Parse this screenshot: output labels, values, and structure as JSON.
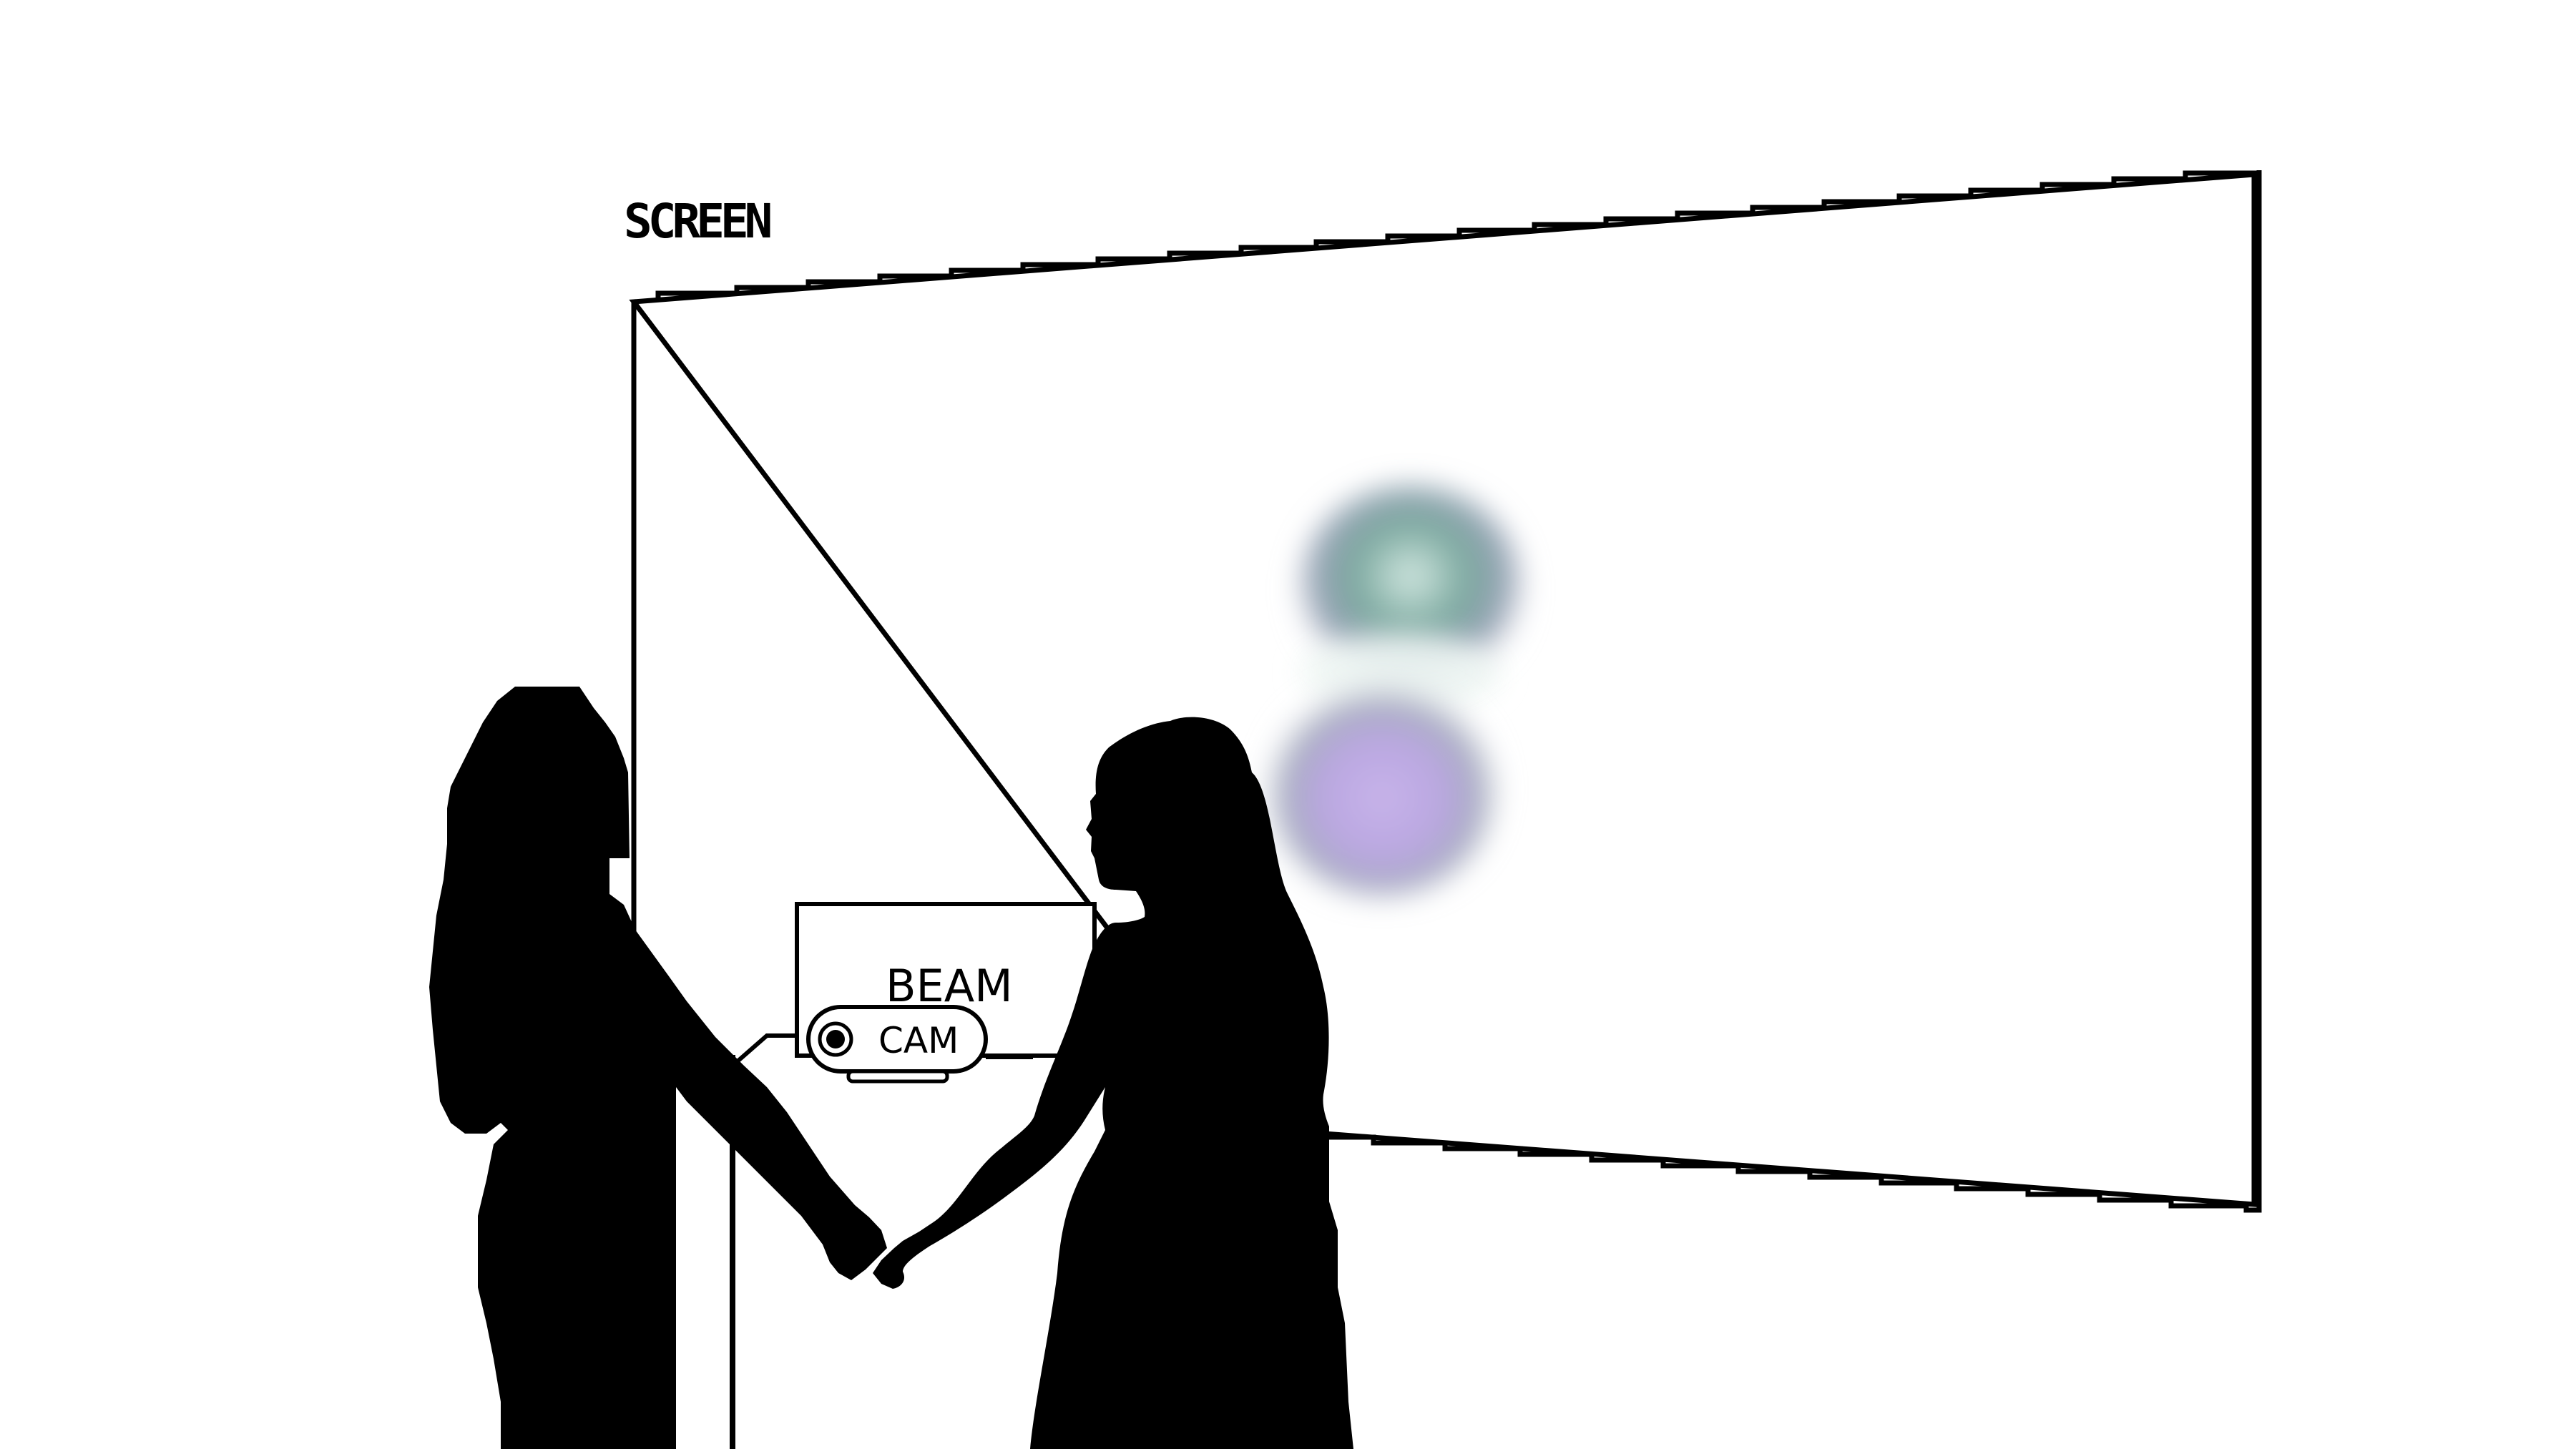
{
  "labels": {
    "screen": "SCREEN",
    "beam": "BEAM",
    "cam": "CAM"
  },
  "colors": {
    "ink": "#000000",
    "background": "#ffffff",
    "glow_teal": "#4f8a80",
    "glow_violet": "#a58bd8"
  },
  "icons": {
    "camera_lens": "camera-lens-icon"
  }
}
